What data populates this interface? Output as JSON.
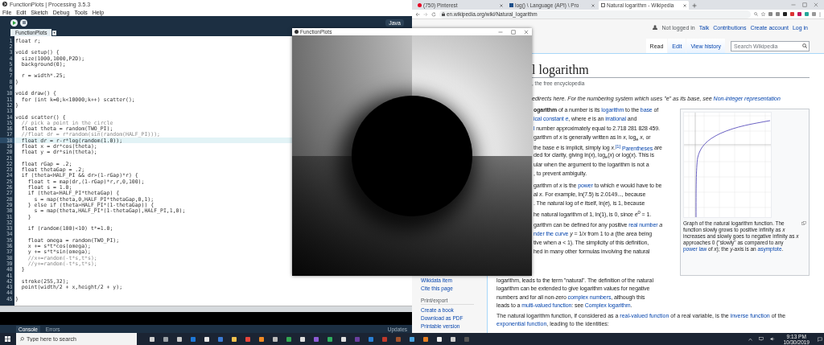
{
  "processing": {
    "title": "FunctionPlots | Processing 3.5.3",
    "menu": [
      "File",
      "Edit",
      "Sketch",
      "Debug",
      "Tools",
      "Help"
    ],
    "mode": "Java",
    "tabs": [
      {
        "label": "FunctionPlots",
        "selected": true
      }
    ],
    "code_lines": [
      {
        "number": "1",
        "text": "float r;",
        "kind": "code",
        "current": false
      },
      {
        "number": "2",
        "kind": "blank",
        "current": false
      },
      {
        "number": "3",
        "text": "void setup() {",
        "kind": "code",
        "current": false
      },
      {
        "number": "4",
        "text": "  size(1000,1000,P2D);",
        "kind": "code",
        "current": false
      },
      {
        "number": "5",
        "text": "  background(0);",
        "kind": "code",
        "current": false
      },
      {
        "number": "6",
        "kind": "blank",
        "current": false
      },
      {
        "number": "7",
        "text": "  r = width*.25;",
        "kind": "code",
        "current": false
      },
      {
        "number": "8",
        "text": "}",
        "kind": "code",
        "current": false
      },
      {
        "number": "9",
        "kind": "blank",
        "current": false
      },
      {
        "number": "10",
        "text": "void draw() {",
        "kind": "code",
        "current": false
      },
      {
        "number": "11",
        "text": "  for (int k=0;k<10000;k++) scatter();",
        "kind": "code",
        "current": false
      },
      {
        "number": "12",
        "text": "}",
        "kind": "code",
        "current": false
      },
      {
        "number": "13",
        "kind": "blank",
        "current": false
      },
      {
        "number": "14",
        "text": "void scatter() {",
        "kind": "code",
        "current": false
      },
      {
        "number": "15",
        "text": "  // pick a point in the circle",
        "kind": "comment",
        "current": false
      },
      {
        "number": "16",
        "text": "  float theta = random(TWO_PI);",
        "kind": "code",
        "current": false
      },
      {
        "number": "17",
        "text": "  //float dr = r*random(sin(random(HALF_PI)));",
        "kind": "comment",
        "current": false
      },
      {
        "number": "18",
        "text": "  float dr = r-r*log(random(1.0));",
        "kind": "code",
        "current": true
      },
      {
        "number": "19",
        "text": "  float x = dr*cos(theta);",
        "kind": "code",
        "current": false
      },
      {
        "number": "20",
        "text": "  float y = dr*sin(theta);",
        "kind": "code",
        "current": false
      },
      {
        "number": "21",
        "kind": "blank",
        "current": false
      },
      {
        "number": "22",
        "text": "  float rGap = .2;",
        "kind": "code",
        "current": false
      },
      {
        "number": "23",
        "text": "  float thetaGap = .2;",
        "kind": "code",
        "current": false
      },
      {
        "number": "24",
        "text": "  if (theta<HALF_PI && dr>(1-rGap)*r) {",
        "kind": "code",
        "current": false
      },
      {
        "number": "25",
        "text": "    float t = map(dr,(1-rGap)*r,r,0,100);",
        "kind": "code",
        "current": false
      },
      {
        "number": "26",
        "text": "    float s = 1.0;",
        "kind": "code",
        "current": false
      },
      {
        "number": "27",
        "text": "    if (theta<HALF_PI*thetaGap) {",
        "kind": "code",
        "current": false
      },
      {
        "number": "28",
        "text": "      s = map(theta,0,HALF_PI*thetaGap,0,1);",
        "kind": "code",
        "current": false
      },
      {
        "number": "29",
        "text": "    } else if (theta>HALF_PI*(1-thetaGap)) {",
        "kind": "code",
        "current": false
      },
      {
        "number": "30",
        "text": "      s = map(theta,HALF_PI*(1-thetaGap),HALF_PI,1,0);",
        "kind": "code",
        "current": false
      },
      {
        "number": "31",
        "text": "    }",
        "kind": "code",
        "current": false
      },
      {
        "number": "32",
        "kind": "blank",
        "current": false
      },
      {
        "number": "33",
        "text": "    if (random(100)<10) t*=1.0;",
        "kind": "code",
        "current": false
      },
      {
        "number": "34",
        "kind": "blank",
        "current": false
      },
      {
        "number": "35",
        "text": "    float omega = random(TWO_PI);",
        "kind": "code",
        "current": false
      },
      {
        "number": "36",
        "text": "    x += s*t*cos(omega);",
        "kind": "code",
        "current": false
      },
      {
        "number": "37",
        "text": "    y += s*t*sin(omega);",
        "kind": "code",
        "current": false
      },
      {
        "number": "38",
        "text": "    //x+=random(-t*s,t*s);",
        "kind": "comment",
        "current": false
      },
      {
        "number": "39",
        "text": "    //y+=random(-t*s,t*s);",
        "kind": "comment",
        "current": false
      },
      {
        "number": "40",
        "text": "  }",
        "kind": "code",
        "current": false
      },
      {
        "number": "41",
        "kind": "blank",
        "current": false
      },
      {
        "number": "42",
        "text": "  stroke(255,32);",
        "kind": "code",
        "current": false
      },
      {
        "number": "43",
        "text": "  point(width/2 + x,height/2 + y);",
        "kind": "code",
        "current": false
      },
      {
        "number": "44",
        "kind": "blank",
        "current": false
      },
      {
        "number": "45",
        "text": "}",
        "kind": "code",
        "current": false
      }
    ],
    "console_tabs": [
      {
        "label": "Console",
        "selected": true
      },
      {
        "label": "Errors",
        "selected": false
      }
    ],
    "updates": "Updates"
  },
  "sketch_window": {
    "title": "FunctionPlots"
  },
  "browser": {
    "tabs": [
      {
        "label": "(750) Pinterest",
        "selected": false
      },
      {
        "label": "log() \\ Language (API) \\ Pro",
        "selected": false
      },
      {
        "label": "Natural logarithm - Wikipedia",
        "selected": true
      }
    ],
    "url": "en.wikipedia.org/wiki/Natural_logarithm",
    "wiki": {
      "user_links": [
        {
          "text": "Not logged in",
          "kind": "status"
        },
        {
          "text": "Talk",
          "kind": "link"
        },
        {
          "text": "Contributions",
          "kind": "link"
        },
        {
          "text": "Create account",
          "kind": "link"
        },
        {
          "text": "Log in",
          "kind": "link"
        }
      ],
      "view_tabs": [
        {
          "label": "Read",
          "selected": true
        },
        {
          "label": "Edit",
          "selected": false
        },
        {
          "label": "View history",
          "selected": false
        }
      ],
      "search": {
        "placeholder": "Search Wikipedia"
      },
      "title": "l logarithm",
      "subtitle": ", the free encyclopedia",
      "hatnote": [
        {
          "text": "edirects here. For the numbering system which uses \"e\" as its base, see ",
          "kind": "plain"
        },
        {
          "text": "Non-integer representation",
          "kind": "link"
        }
      ],
      "upper_paragraphs": [
        [
          [
            {
              "text": "ogarithm",
              "kind": "bold"
            },
            {
              "text": " of a number is its ",
              "kind": "plain"
            },
            {
              "text": "logarithm",
              "kind": "link"
            },
            {
              "text": " to the ",
              "kind": "plain"
            },
            {
              "text": "base",
              "kind": "link"
            },
            {
              "text": " of",
              "kind": "plain"
            }
          ],
          [
            {
              "text": "ical constant *e*",
              "kind": "link"
            },
            {
              "text": ", where *e* is an ",
              "kind": "plain"
            },
            {
              "text": "irrational",
              "kind": "link"
            },
            {
              "text": " and",
              "kind": "plain"
            }
          ],
          [
            {
              "text": "l",
              "kind": "link"
            },
            {
              "text": " number approximately equal to 2.718 281 828 459.",
              "kind": "plain"
            }
          ],
          [
            {
              "text": "garithm of *x* is generally written as ln *x*, log$_{e}$ *x*, or",
              "kind": "plain"
            }
          ],
          [
            {
              "text": "the base *e* is implicit, simply log *x*.",
              "kind": "plain"
            },
            {
              "text": "$^{[1]}$",
              "kind": "link"
            },
            {
              "text": "Parentheses",
              "kind": "link"
            },
            {
              "text": " are",
              "kind": "plain"
            }
          ],
          [
            {
              "text": "ded for clarity, giving ln(*x*), log$_{e}$(*x*) or log(*x*). This is",
              "kind": "plain"
            }
          ],
          [
            {
              "text": "ular when the argument to the logarithm is not a",
              "kind": "plain"
            }
          ],
          [
            {
              "text": ", to prevent ambiguity.",
              "kind": "plain"
            }
          ]
        ],
        [
          [
            {
              "text": "garithm of *x* is the ",
              "kind": "plain"
            },
            {
              "text": "power",
              "kind": "link"
            },
            {
              "text": " to which *e* would have to be",
              "kind": "plain"
            }
          ],
          [
            {
              "text": "al *x*. For example, ln(7.5) is 2.0149..., because",
              "kind": "plain"
            }
          ],
          [
            {
              "text": ". The natural log of *e* itself, ln(*e*), is 1, because",
              "kind": "plain"
            }
          ],
          [
            {
              "text": "he natural logarithm of 1, ln(1), is 0, since *e*$^{0}$ = 1.",
              "kind": "plain"
            }
          ]
        ],
        [
          [
            {
              "text": "garithm can be defined for any positive ",
              "kind": "plain"
            },
            {
              "text": "real number",
              "kind": "link"
            },
            {
              "text": " *a*",
              "kind": "plain"
            }
          ],
          [
            {
              "text": "nder the curve",
              "kind": "link"
            },
            {
              "text": " *y* = 1/*x* from 1 to *a* (the area being",
              "kind": "plain"
            }
          ],
          [
            {
              "text": "tive when *a* < 1). The simplicity of this definition,",
              "kind": "plain"
            }
          ],
          [
            {
              "text": "hed in many other formulas involving the natural",
              "kind": "plain"
            }
          ]
        ]
      ],
      "lower_lines": [
        [
          {
            "text": "logarithm, leads to the term \"natural\". The definition of the natural",
            "kind": "plain"
          }
        ],
        [
          {
            "text": "logarithm can be extended to give logarithm values for negative",
            "kind": "plain"
          }
        ],
        [
          {
            "text": "numbers and for all non-zero ",
            "kind": "plain"
          },
          {
            "text": "complex numbers",
            "kind": "link"
          },
          {
            "text": ", although this",
            "kind": "plain"
          }
        ],
        [
          {
            "text": "leads to a ",
            "kind": "plain"
          },
          {
            "text": "multi-valued function",
            "kind": "link"
          },
          {
            "text": ": see ",
            "kind": "plain"
          },
          {
            "text": "Complex logarithm",
            "kind": "link"
          },
          {
            "text": ".",
            "kind": "plain"
          }
        ]
      ],
      "last_paragraph": [
        {
          "text": "The natural logarithm function, if considered as a ",
          "kind": "plain"
        },
        {
          "text": "real-valued function",
          "kind": "link"
        },
        {
          "text": " of a real variable, is the ",
          "kind": "plain"
        },
        {
          "text": "inverse function",
          "kind": "link"
        },
        {
          "text": " of the ",
          "kind": "plain"
        },
        {
          "text": "exponential function",
          "kind": "link"
        },
        {
          "text": ", leading to the identities:",
          "kind": "plain"
        }
      ],
      "figure": {
        "caption": [
          {
            "text": "Graph of the natural logarithm function. The function slowly grows to positive infinity as *x* increases and slowly goes to negative infinity as *x* approaches 0 (\"slowly\" as compared to any ",
            "kind": "plain"
          },
          {
            "text": "power law",
            "kind": "link"
          },
          {
            "text": " of *x*); the *y*-axis is an ",
            "kind": "plain"
          },
          {
            "text": "asymptote",
            "kind": "link"
          },
          {
            "text": ".",
            "kind": "plain"
          }
        ]
      },
      "sidebar": [
        {
          "text": "Wikidata item",
          "kind": "link"
        },
        {
          "text": "Cite this page",
          "kind": "link"
        },
        {
          "text": "Print/export",
          "kind": "heading"
        },
        {
          "text": "Create a book",
          "kind": "link"
        },
        {
          "text": "Download as PDF",
          "kind": "link"
        },
        {
          "text": "Printable version",
          "kind": "link"
        }
      ]
    }
  },
  "taskbar": {
    "search": {
      "placeholder": "Type here to search"
    },
    "apps": [
      {
        "color": "#d0d0d0"
      },
      {
        "color": "#9aa0a6"
      },
      {
        "color": "#c8c8c8"
      },
      {
        "color": "#1e78d7"
      },
      {
        "color": "#e6e6e6"
      },
      {
        "color": "#3b7bd4"
      },
      {
        "color": "#f2c14e"
      },
      {
        "color": "#e8453c"
      },
      {
        "color": "#f08a24"
      },
      {
        "color": "#bbbbbb"
      },
      {
        "color": "#33a852"
      },
      {
        "color": "#dddddd"
      },
      {
        "color": "#8e5bd6"
      },
      {
        "color": "#2fae5f"
      },
      {
        "color": "#e0e0e0"
      },
      {
        "color": "#6b3fa0"
      },
      {
        "color": "#2a7fd4"
      },
      {
        "color": "#c0392b"
      },
      {
        "color": "#a0522d"
      },
      {
        "color": "#4aa3df"
      },
      {
        "color": "#e67e22"
      },
      {
        "color": "#ededed"
      },
      {
        "color": "#cccccc"
      },
      {
        "color": "#555555"
      }
    ],
    "time": "9:13 PM",
    "date": "10/30/2019"
  }
}
